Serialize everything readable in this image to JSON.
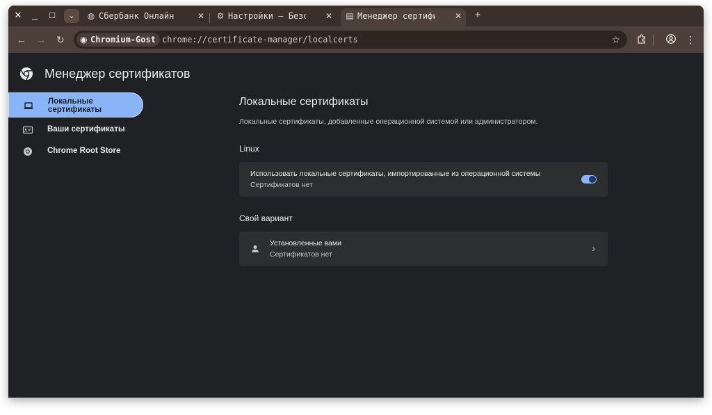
{
  "window_controls": {
    "close": "✕",
    "minimize": "_",
    "maximize": "□",
    "tabs_menu": "⌄"
  },
  "tabs": [
    {
      "title": "Сбербанк Онлайн",
      "icon": "globe-icon",
      "close": "✕"
    },
    {
      "title": "Настройки – Безопасн",
      "icon": "gear-icon",
      "close": "✕"
    },
    {
      "title": "Менеджер сертификатов",
      "icon": "certificate-icon",
      "close": "✕",
      "active": true
    }
  ],
  "new_tab": "+",
  "toolbar": {
    "back": "←",
    "forward": "→",
    "reload": "↻",
    "site_chip": "Chromium-Gost",
    "url": "chrome://certificate-manager/localcerts",
    "bookmark": "☆",
    "extensions": "extensions-icon",
    "profile": "profile-icon",
    "menu": "⋮"
  },
  "page": {
    "title": "Менеджер сертификатов",
    "nav": [
      {
        "label_line1": "Локальные",
        "label_line2": "сертификаты",
        "icon": "laptop-icon",
        "selected": true
      },
      {
        "label": "Ваши сертификаты",
        "icon": "id-card-icon"
      },
      {
        "label": "Chrome Root Store",
        "icon": "chrome-icon"
      }
    ],
    "section_title": "Локальные сертификаты",
    "section_desc": "Локальные сертификаты, добавленные операционной системой или администратором.",
    "linux": {
      "heading": "Linux",
      "row_title": "Использовать локальные сертификаты, импортированные из операционной системы",
      "row_sub": "Сертификатов нет",
      "toggle_on": true
    },
    "custom": {
      "heading": "Свой вариант",
      "row_title": "Установленные вами",
      "row_sub": "Сертификатов нет",
      "chevron": "›"
    }
  },
  "colors": {
    "accent": "#8ab4f8",
    "page_bg": "#202124",
    "card_bg": "#2d2e30",
    "frame": "#4d403a"
  }
}
